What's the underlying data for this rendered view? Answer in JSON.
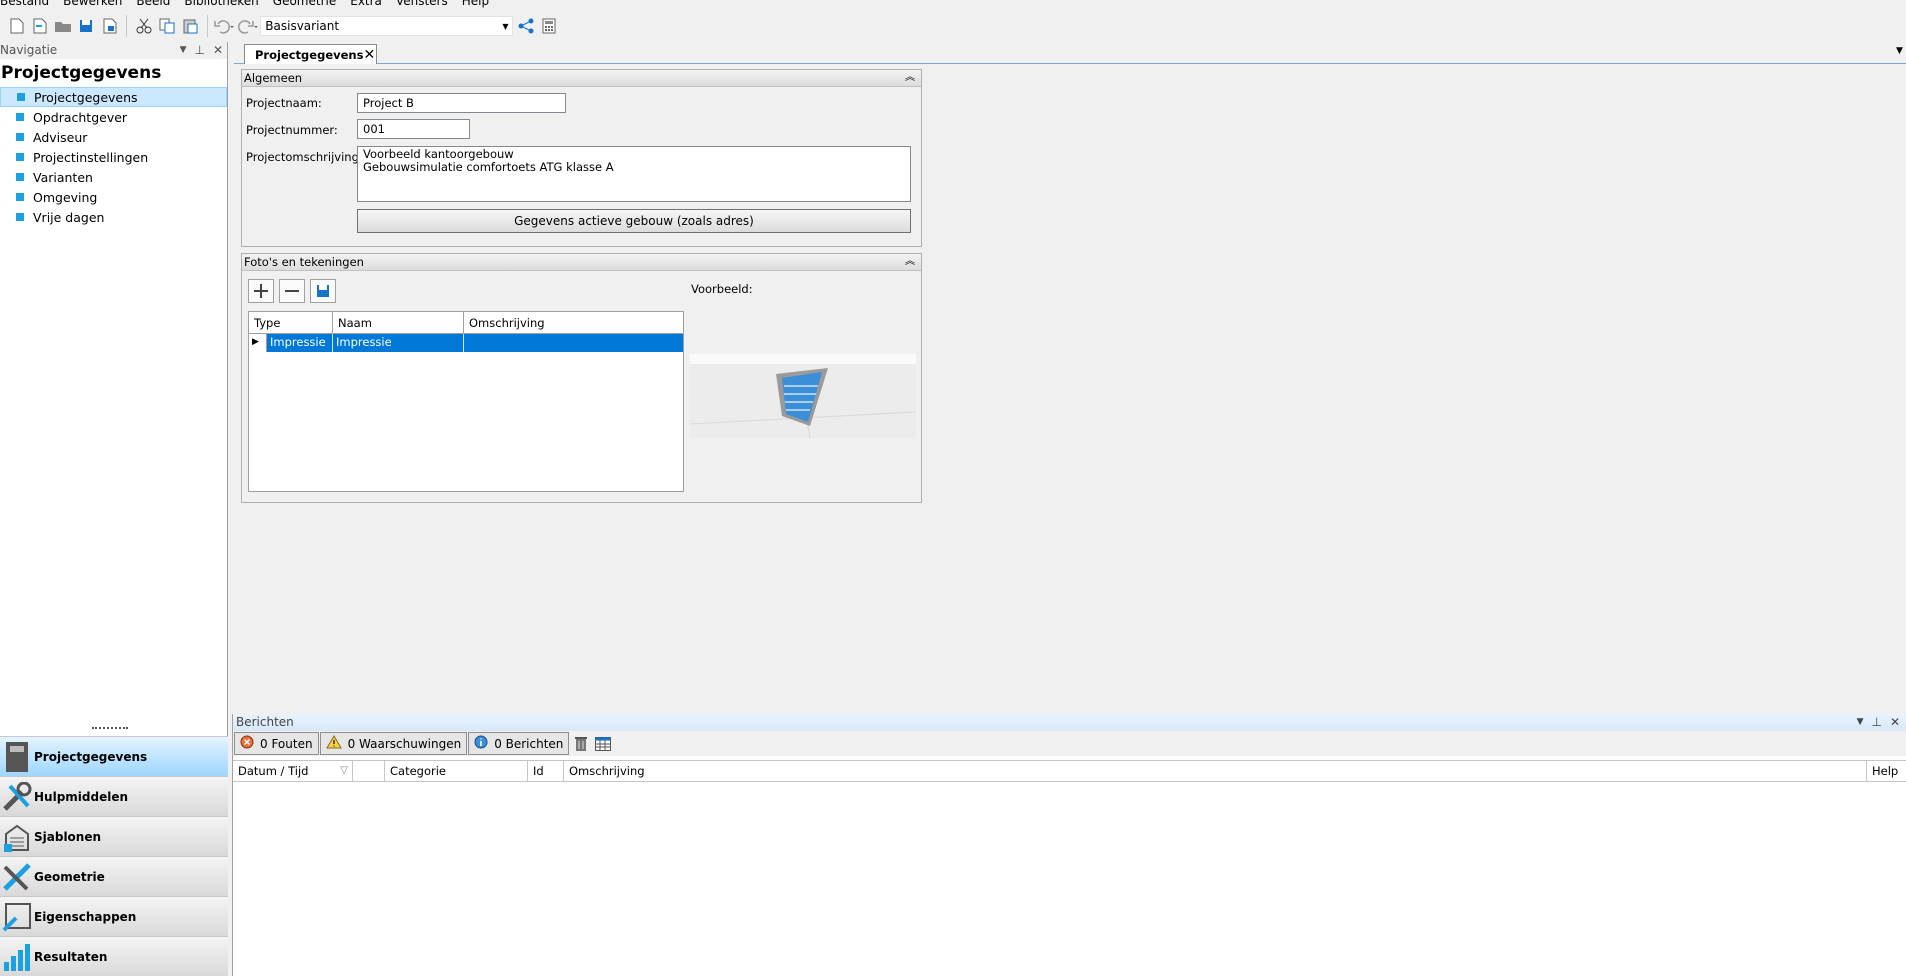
{
  "menu": [
    "Bestand",
    "Bewerken",
    "Beeld",
    "Bibliotheken",
    "Geometrie",
    "Extra",
    "Vensters",
    "Help"
  ],
  "toolbar": {
    "variant": "Basisvariant"
  },
  "nav": {
    "header": "Navigatie",
    "title": "Projectgegevens",
    "items": [
      "Projectgegevens",
      "Opdrachtgever",
      "Adviseur",
      "Projectinstellingen",
      "Varianten",
      "Omgeving",
      "Vrije dagen"
    ],
    "buttons": [
      "Projectgegevens",
      "Hulpmiddelen",
      "Sjablonen",
      "Geometrie",
      "Eigenschappen",
      "Resultaten"
    ]
  },
  "tab": {
    "label": "Projectgegevens"
  },
  "algemeen": {
    "title": "Algemeen",
    "projectnaam_label": "Projectnaam:",
    "projectnaam": "Project B",
    "projectnummer_label": "Projectnummer:",
    "projectnummer": "001",
    "omschrijving_label": "Projectomschrijving:",
    "omschrijving_line1": "Voorbeeld kantoorgebouw",
    "omschrijving_line2": "Gebouwsimulatie comfortoets ATG klasse A",
    "gegevens_button": "Gegevens actieve gebouw (zoals adres)"
  },
  "fotos": {
    "title": "Foto's en tekeningen",
    "preview_label": "Voorbeeld:",
    "columns": [
      "Type",
      "Naam",
      "Omschrijving"
    ],
    "rows": [
      {
        "type": "Impressie",
        "naam": "Impressie",
        "omschrijving": ""
      }
    ]
  },
  "messages": {
    "header": "Berichten",
    "errors": "0 Fouten",
    "warnings": "0 Waarschuwingen",
    "messages": "0 Berichten",
    "columns": [
      "Datum / Tijd",
      "",
      "Categorie",
      "Id",
      "Omschrijving",
      "Help"
    ]
  },
  "colors": {
    "accent": "#1ba1e2",
    "selection": "#0078d7"
  }
}
